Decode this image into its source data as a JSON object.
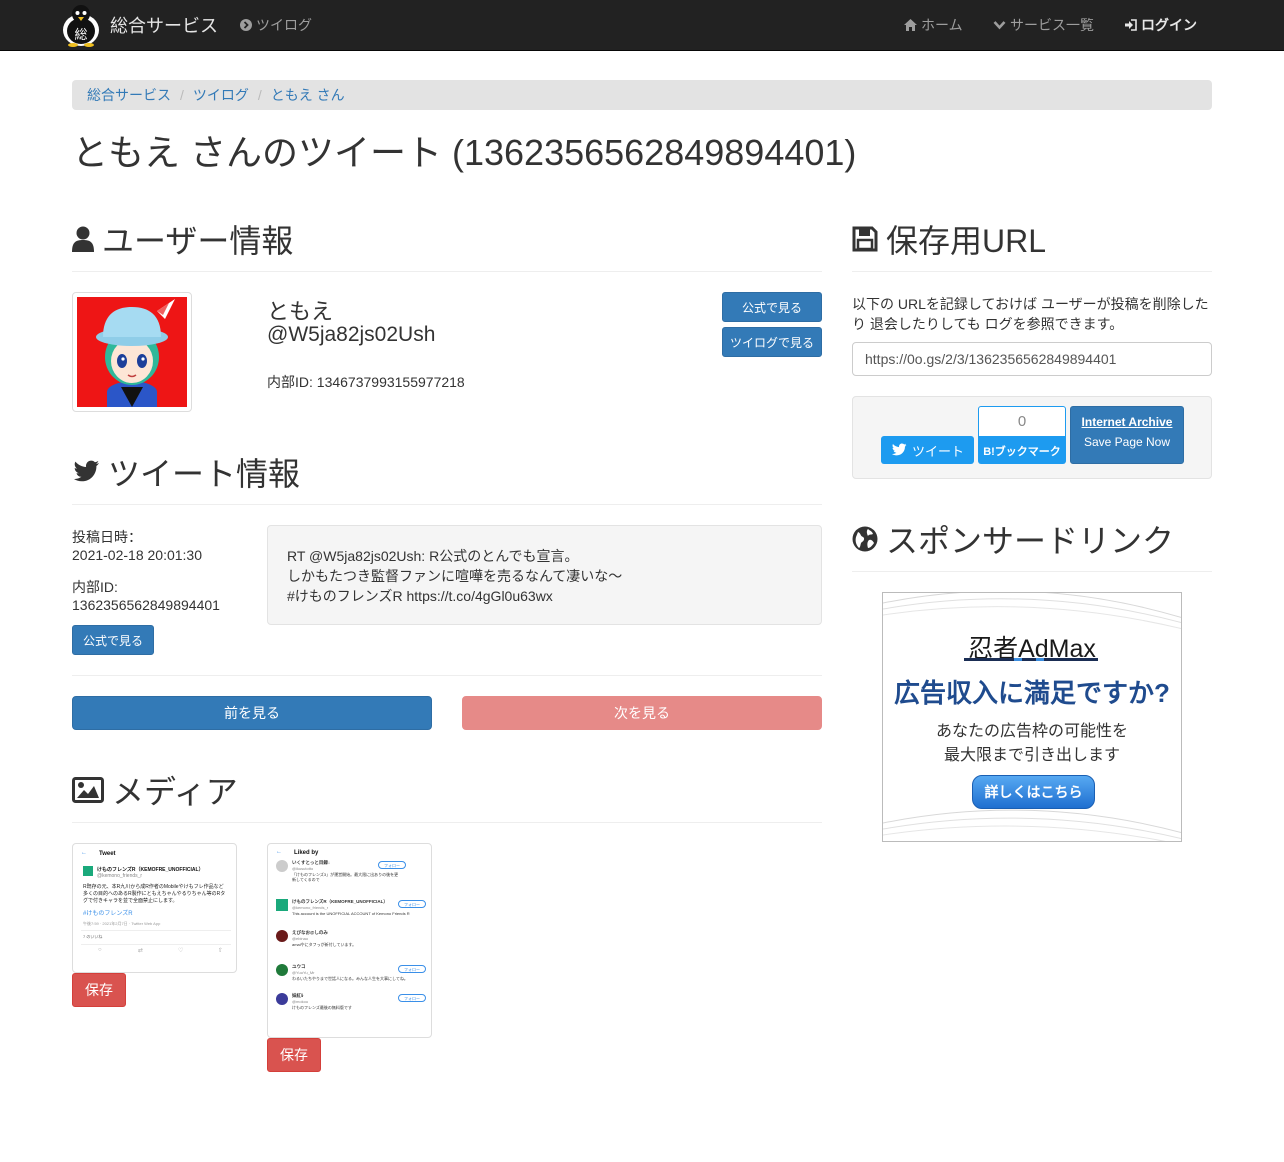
{
  "navbar": {
    "brand": "総合サービス",
    "tsuilog": "ツイログ",
    "home": "ホーム",
    "services": "サービス一覧",
    "login": "ログイン"
  },
  "breadcrumb": [
    "総合サービス",
    "ツイログ",
    "ともえ さん"
  ],
  "page_title": "ともえ さんのツイート (1362356562849894401)",
  "user_section": {
    "heading": "ユーザー情報",
    "name": "ともえ",
    "handle": "@W5ja82js02Ush",
    "internal_id": "内部ID: 1346737993155977218",
    "official_button": "公式で見る",
    "tsuilog_button": "ツイログで見る"
  },
  "tweet_section": {
    "heading": "ツイート情報",
    "posted_label": "投稿日時：",
    "posted_value": "2021-02-18 20:01:30",
    "id_label": "内部ID:",
    "id_value": "1362356562849894401",
    "official_button": "公式で見る",
    "text_lines": [
      "RT @W5ja82js02Ush: R公式のとんでも宣言。",
      "しかもたつき監督ファンに喧嘩を売るなんて凄いな〜",
      "#けものフレンズR https://t.co/4gGl0u63wx"
    ]
  },
  "pager": {
    "prev": "前を見る",
    "next": "次を見る"
  },
  "media_section": {
    "heading": "メディア",
    "save_label": "保存",
    "thumb1": {
      "title": "Tweet",
      "account": "けものフレンズR（KEMOFRE_UNOFFICIAL）",
      "handle": "@kemono_friends_r",
      "body": "R既存の元、本R九川から成R作者のMobileやけもフレ作品など多くの目的へのあるR製作にともえちゃんやるりちゃん等のRタグで付きキャラを並で全面禁止にします。",
      "hashtag": "#けものフレンズR",
      "footer": "午後7:59 · 2021年2月7日 · Twitter Web App",
      "counts": "7 のいいね"
    },
    "thumb2": {
      "title": "Liked by",
      "follow": "フォロー",
      "users": [
        {
          "name": "いくすとっと目録↓",
          "handle": "@ikusutotto",
          "text": "「けものフレンズ3」が運営開始。最大限に出ありの後を更新してくるので"
        },
        {
          "name": "けものフレンズR（KEMOFRE_UNOFFICIAL）",
          "handle": "@kemono_friends_r",
          "text": "This account is the UNOFFICIAL ACCOUNT of Kemono Friends R"
        },
        {
          "name": "えびなお@しのみ",
          "handle": "@ebinao",
          "text": "amalやにタフっが新付しています。"
        },
        {
          "name": "ユウコ",
          "handle": "@YuuYu_Mr",
          "text": "わるいたちやりまで世話人になる。みんな人生を大事にしてね。"
        },
        {
          "name": "妹紅ﾙ",
          "handle": "@mokou",
          "text": "けものフレンズ最後の無料版です"
        }
      ]
    }
  },
  "save_section": {
    "heading": "保存用URL",
    "description_line1": "以下の URLを記録しておけば ユーザーが投稿を削除した",
    "description_line2": "り 退会したりしても ログを参照できます。",
    "url": "https://0o.gs/2/3/1362356562849894401",
    "tweet_button": "ツイート",
    "hatena_count": "0",
    "hatena_button": "B!ブックマーク",
    "ia_title": "Internet Archive",
    "ia_sub": "Save Page Now"
  },
  "sponsor_section": {
    "heading": "スポンサードリンク",
    "ad_brand": "忍者AdMax",
    "ad_headline": "広告収入に満足ですか?",
    "ad_line1": "あなたの広告枠の可能性を",
    "ad_line2": "最大限まで引き出します",
    "ad_button": "詳しくはこちら"
  }
}
